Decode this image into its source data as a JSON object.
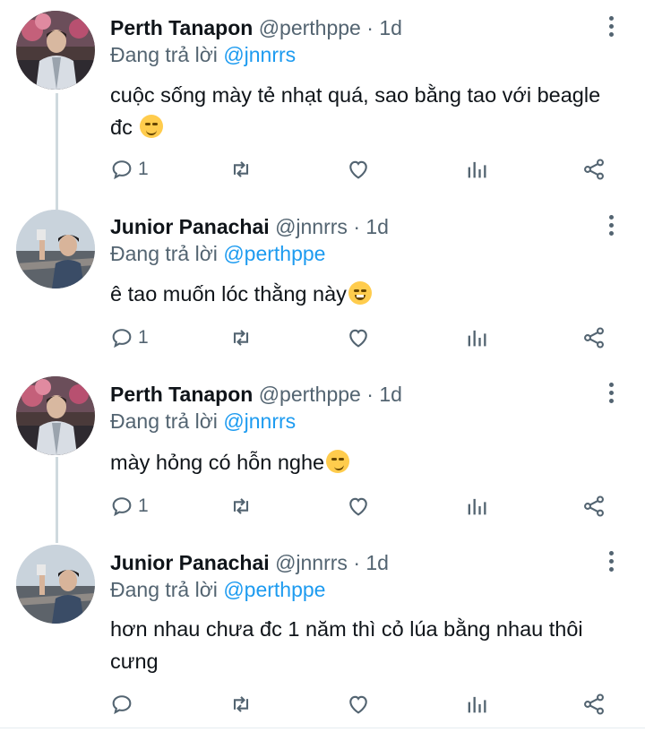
{
  "tweets": [
    {
      "name": "Perth Tanapon",
      "handle": "@perthppe",
      "time": "1d",
      "reply_prefix": "Đang trả lời",
      "reply_to": "@jnnrrs",
      "text_line1": "cuộc sống mày tẻ nhạt quá, sao bằng tao với beagle",
      "text_line2": "đc",
      "emoji": "relieved-face",
      "reply_count": "1"
    },
    {
      "name": "Junior Panachai",
      "handle": "@jnnrrs",
      "time": "1d",
      "reply_prefix": "Đang trả lời",
      "reply_to": "@perthppe",
      "text_line1": "ê tao muốn lóc thằng này",
      "emoji": "grinning-face",
      "reply_count": "1"
    },
    {
      "name": "Perth Tanapon",
      "handle": "@perthppe",
      "time": "1d",
      "reply_prefix": "Đang trả lời",
      "reply_to": "@jnnrrs",
      "text_line1": "mày hỏng có hỗn nghe",
      "emoji": "smirking-face",
      "reply_count": "1"
    },
    {
      "name": "Junior Panachai",
      "handle": "@jnnrrs",
      "time": "1d",
      "reply_prefix": "Đang trả lời",
      "reply_to": "@perthppe",
      "text_line1": "hơn nhau chưa đc 1 năm thì cỏ lúa bằng nhau thôi",
      "text_line2": "cưng",
      "reply_count": ""
    }
  ],
  "separator": "·",
  "colors": {
    "text": "#0f1419",
    "secondary": "#536471",
    "accent": "#1d9bf0",
    "thread": "#cfd9de"
  },
  "icons": [
    "reply-icon",
    "retweet-icon",
    "like-icon",
    "analytics-icon",
    "share-icon",
    "more-icon"
  ]
}
